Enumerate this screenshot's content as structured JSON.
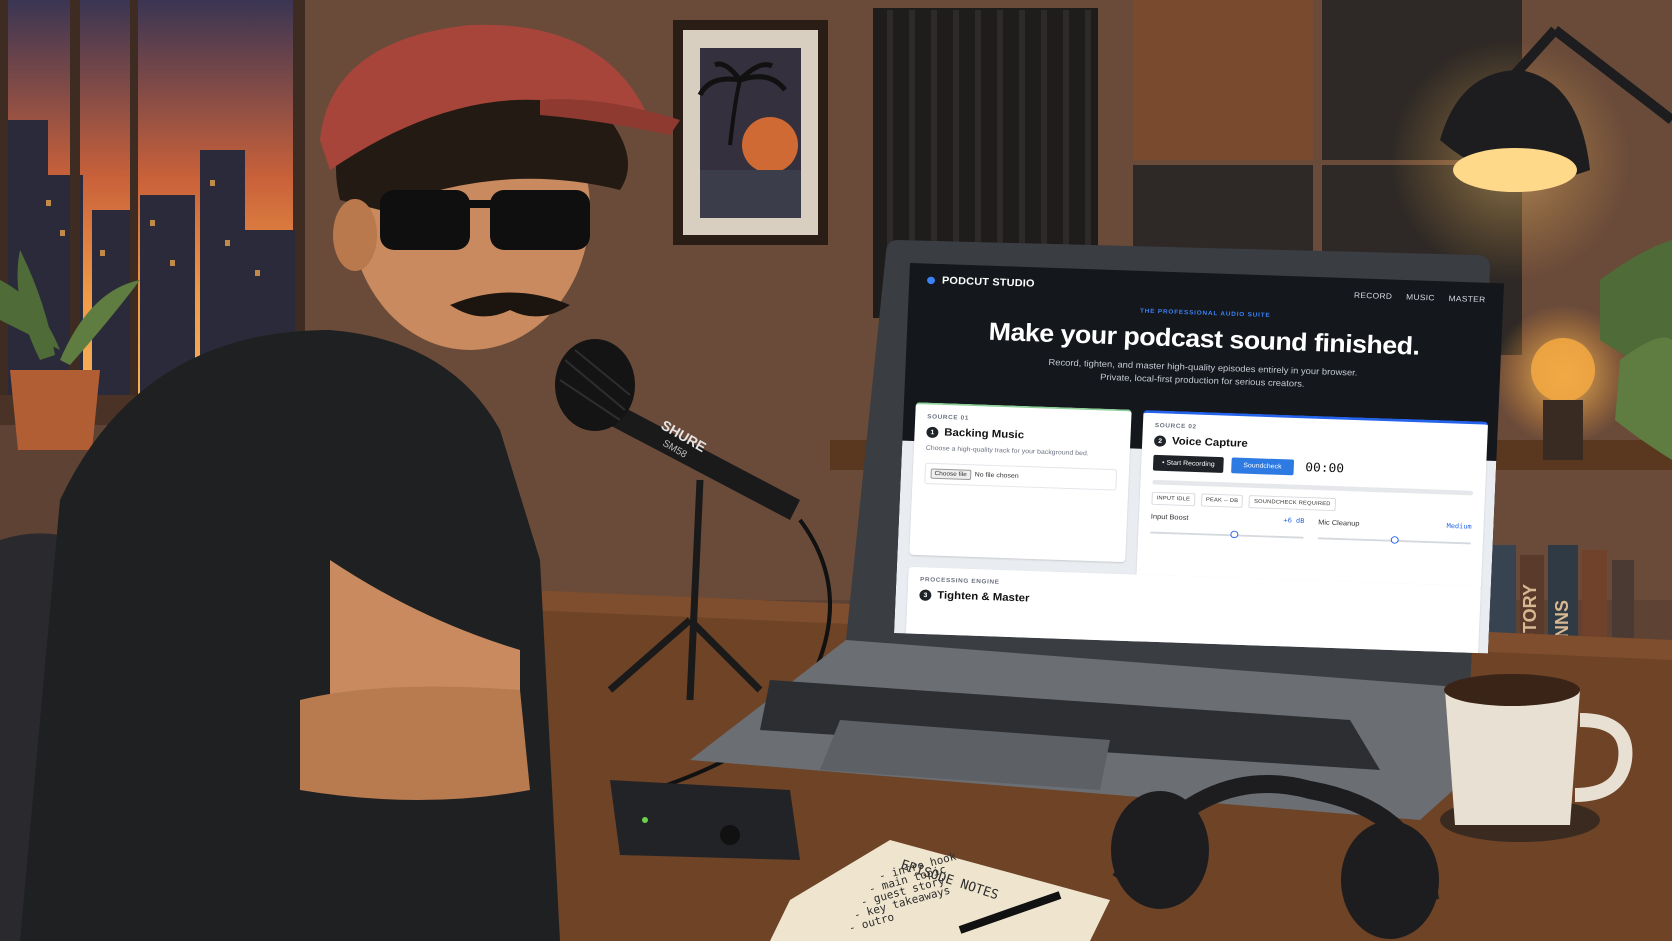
{
  "app": {
    "brand": "PODCUT STUDIO",
    "nav_links": [
      "RECORD",
      "MUSIC",
      "MASTER"
    ],
    "accent_color": "#3b82f6"
  },
  "hero": {
    "eyebrow": "THE PROFESSIONAL AUDIO SUITE",
    "headline": "Make your podcast sound finished.",
    "subline_1": "Record, tighten, and master high-quality episodes entirely in your browser.",
    "subline_2": "Private, local-first production for serious creators."
  },
  "source_music": {
    "kicker": "SOURCE 01",
    "step": "1",
    "title": "Backing Music",
    "description": "Choose a high-quality track for your background bed.",
    "file_button": "Choose file",
    "file_status": "No file chosen"
  },
  "source_voice": {
    "kicker": "SOURCE 02",
    "step": "2",
    "title": "Voice Capture",
    "record_button": "• Start Recording",
    "soundcheck_button": "Soundcheck",
    "timer": "00:00",
    "status_pills": [
      "INPUT IDLE",
      "PEAK -- DB",
      "SOUNDCHECK REQUIRED"
    ],
    "input_boost": {
      "label": "Input Boost",
      "value": "+6 dB",
      "level": 0.55
    },
    "mic_cleanup": {
      "label": "Mic Cleanup",
      "value": "Medium",
      "level": 0.5
    }
  },
  "engine": {
    "kicker": "PROCESSING ENGINE",
    "step": "3",
    "title": "Tighten & Master"
  },
  "scene_text": {
    "mic_brand": "SHURE",
    "mic_model": "SM58",
    "notebook_title": "EPISODE NOTES",
    "notebook_lines": [
      "- intro hook",
      "- main topic",
      "- guest story",
      "- key takeaways",
      "- outro"
    ],
    "book_spines": [
      "STORY",
      "SNNS"
    ]
  },
  "colors": {
    "window_sky": "#e0743a",
    "wall": "#6b4a37",
    "desk": "#6e4326",
    "cap": "#a8453a",
    "shirt": "#1f2022",
    "skin": "#c88a5e"
  }
}
